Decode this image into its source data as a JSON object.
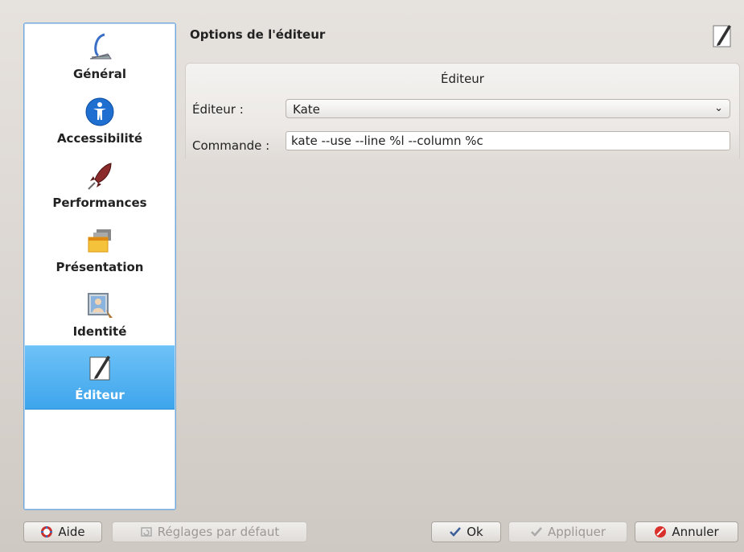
{
  "sidebar": {
    "items": [
      {
        "label": "Général",
        "icon": "general-icon"
      },
      {
        "label": "Accessibilité",
        "icon": "accessibility-icon"
      },
      {
        "label": "Performances",
        "icon": "rocket-icon"
      },
      {
        "label": "Présentation",
        "icon": "presentation-icon"
      },
      {
        "label": "Identité",
        "icon": "identity-icon"
      },
      {
        "label": "Éditeur",
        "icon": "editor-icon",
        "selected": true
      }
    ]
  },
  "header": {
    "title": "Options de l'éditeur",
    "icon": "editor-icon"
  },
  "group": {
    "title": "Éditeur",
    "editor_label": "Éditeur :",
    "editor_value": "Kate",
    "command_label": "Commande :",
    "command_value": "kate --use --line %l --column %c"
  },
  "buttons": {
    "help": "Aide",
    "defaults": "Réglages par défaut",
    "ok": "Ok",
    "apply": "Appliquer",
    "cancel": "Annuler"
  },
  "colors": {
    "accent": "#3ea5ec",
    "selected_text": "#ffffff"
  }
}
